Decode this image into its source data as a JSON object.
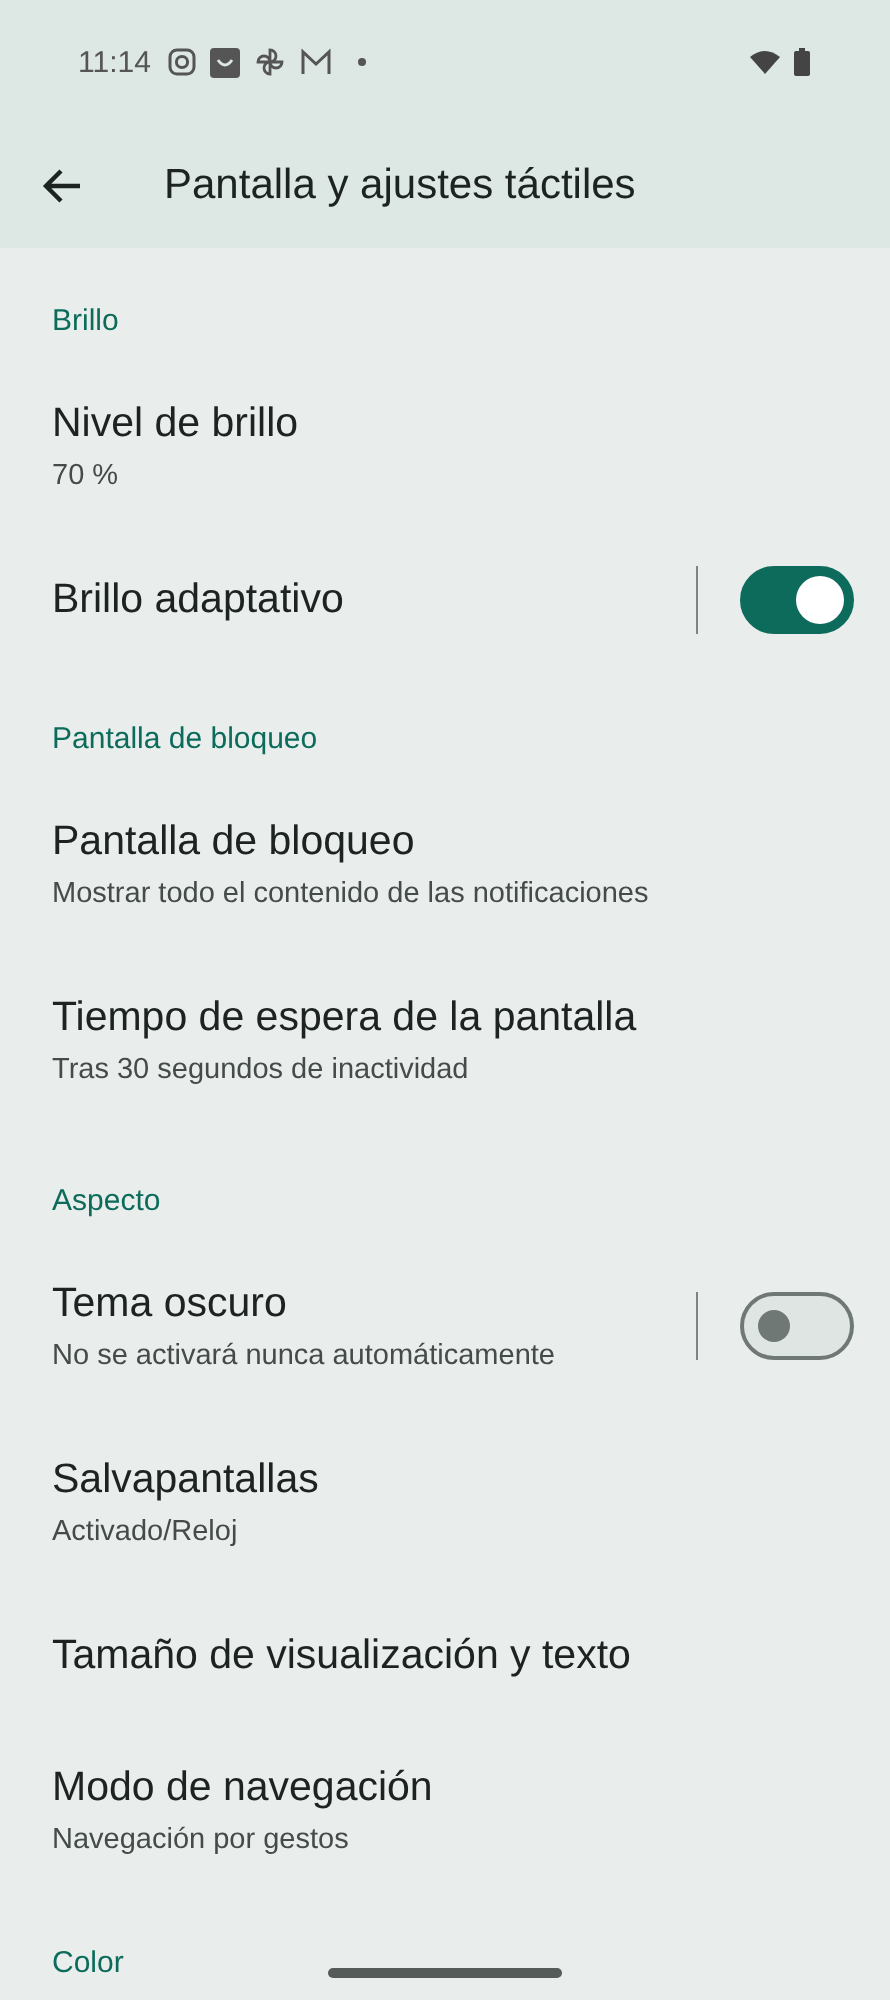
{
  "status_bar": {
    "time": "11:14"
  },
  "app_bar": {
    "title": "Pantalla y ajustes táctiles"
  },
  "sections": [
    {
      "header": "Brillo",
      "items": [
        {
          "kind": "text",
          "title": "Nivel de brillo",
          "subtitle": "70 %"
        },
        {
          "kind": "switch",
          "title": "Brillo adaptativo",
          "on": true
        }
      ]
    },
    {
      "header": "Pantalla de bloqueo",
      "items": [
        {
          "kind": "text",
          "title": "Pantalla de bloqueo",
          "subtitle": "Mostrar todo el contenido de las notificaciones"
        },
        {
          "kind": "text",
          "title": "Tiempo de espera de la pantalla",
          "subtitle": "Tras 30 segundos de inactividad"
        }
      ]
    },
    {
      "header": "Aspecto",
      "items": [
        {
          "kind": "switch",
          "title": "Tema oscuro",
          "subtitle": "No se activará nunca automáticamente",
          "on": false
        },
        {
          "kind": "text",
          "title": "Salvapantallas",
          "subtitle": "Activado/Reloj"
        },
        {
          "kind": "text",
          "title": "Tamaño de visualización y texto"
        },
        {
          "kind": "text",
          "title": "Modo de navegación",
          "subtitle": "Navegación por gestos"
        }
      ]
    },
    {
      "header": "Color"
    }
  ]
}
